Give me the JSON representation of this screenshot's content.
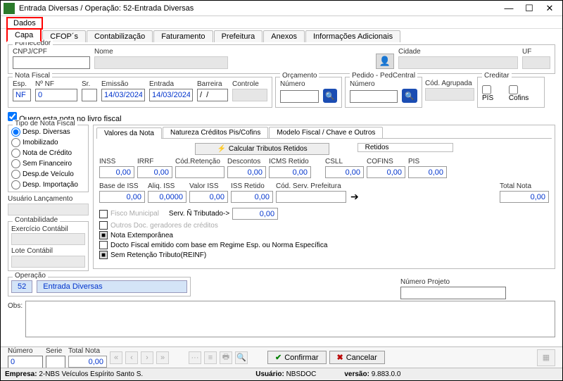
{
  "window": {
    "title": "Entrada Diversas / Operação: 52-Entrada Diversas"
  },
  "menu": {
    "dados": "Dados"
  },
  "tabs": {
    "capa": "Capa",
    "cfop": "CFOP´s",
    "contab": "Contabilização",
    "fatur": "Faturamento",
    "pref": "Prefeitura",
    "anexos": "Anexos",
    "info": "Informações Adicionais"
  },
  "fornecedor": {
    "group": "Fornecedor",
    "cnpj_lbl": "CNPJ/CPF",
    "cnpj": "",
    "nome_lbl": "Nome",
    "nome": "",
    "cidade_lbl": "Cidade",
    "cidade": "",
    "uf_lbl": "UF",
    "uf": ""
  },
  "nota": {
    "group": "Nota Fiscal",
    "esp_lbl": "Esp.",
    "esp": "NF",
    "numnf_lbl": "Nº NF",
    "numnf": "0",
    "sr_lbl": "Sr.",
    "sr": "",
    "emissao_lbl": "Emissão",
    "emissao": "14/03/2024",
    "entrada_lbl": "Entrada",
    "entrada": "14/03/2024",
    "barreira_lbl": "Barreira",
    "barreira": "/  /",
    "controle_lbl": "Controle",
    "controle": "",
    "orc_group": "Orçamento",
    "orc_num_lbl": "Número",
    "orc_num": "",
    "ped_group": "Pedido - PedCentral",
    "ped_num_lbl": "Número",
    "ped_num": "",
    "cod_agr_lbl": "Cód. Agrupada",
    "cod_agr": "",
    "cred_group": "Creditar",
    "pis_lbl": "PIS",
    "cofins_lbl": "Cofins"
  },
  "livro_chk": "Quero esta nota no livro fiscal",
  "tipo_group": "Tipo de Nota Fiscal",
  "tipo_opts": [
    "Desp. Diversas",
    "Imobilizado",
    "Nota de Crédito",
    "Sem Financeiro",
    "Desp.de Veículo",
    "Desp. Importação"
  ],
  "usuario_lbl": "Usuário Lançamento",
  "usuario": "",
  "contab_group": "Contabilidade",
  "exerc_lbl": "Exercício Contábil",
  "exerc": "",
  "lote_lbl": "Lote Contábil",
  "lote": "",
  "subtabs": {
    "valores": "Valores da Nota",
    "natureza": "Natureza Créditos Pis/Cofins",
    "modelo": "Modelo Fiscal / Chave e Outros"
  },
  "calc_btn": "Calcular Tributos Retidos",
  "retidos_label": "Retidos",
  "fields": {
    "inss_lbl": "INSS",
    "inss": "0,00",
    "irrf_lbl": "IRRF",
    "irrf": "0,00",
    "codret_lbl": "Cód.Retenção",
    "codret": "",
    "desc_lbl": "Descontos",
    "desc": "0,00",
    "icms_lbl": "ICMS Retido",
    "icms": "0,00",
    "csll_lbl": "CSLL",
    "csll": "0,00",
    "cofins_lbl": "COFINS",
    "cofins": "0,00",
    "pis_lbl": "PIS",
    "pis": "0,00",
    "base_lbl": "Base de ISS",
    "base": "0,00",
    "aliq_lbl": "Aliq. ISS",
    "aliq": "0,0000",
    "valor_lbl": "Valor ISS",
    "valor": "0,00",
    "issret_lbl": "ISS Retido",
    "issret": "0,00",
    "codserv_lbl": "Cód. Serv. Prefeitura",
    "codserv": "",
    "total_lbl": "Total Nota",
    "total": "0,00"
  },
  "checks": {
    "fisco": "Fisco Municipal",
    "serv": "Serv. Ñ Tributado->",
    "servval": "0,00",
    "outros": "Outros Doc. geradores de créditos",
    "extemp": "Nota Extemporânea",
    "docto": "Docto Fiscal emitido com base em Regime Esp. ou Norma Específica",
    "semret": "Sem Retenção Tributo(REINF)"
  },
  "operacao": {
    "lbl": "Operação",
    "cod": "52",
    "nome": "Entrada Diversas"
  },
  "numproj_lbl": "Número Projeto",
  "numproj": "",
  "obs_lbl": "Obs:",
  "bottom": {
    "numero_lbl": "Número",
    "numero": "0",
    "serie_lbl": "Serie",
    "serie": "",
    "total_lbl": "Total Nota",
    "total": "0,00",
    "confirmar": "Confirmar",
    "cancelar": "Cancelar"
  },
  "status": {
    "empresa_lbl": "Empresa:",
    "empresa": "2-NBS Veículos Espírito Santo S.",
    "usuario_lbl": "Usuário:",
    "usuario": "NBSDOC",
    "versao_lbl": "versão:",
    "versao": "9.883.0.0"
  }
}
